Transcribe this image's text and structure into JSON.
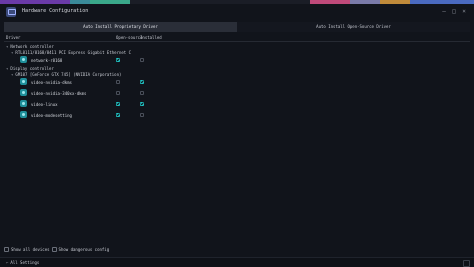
{
  "window": {
    "title": "Hardware Configuration"
  },
  "tabs": [
    {
      "label": "Auto Install Proprietary Driver",
      "active": true
    },
    {
      "label": "Auto Install Open-Source Driver",
      "active": false
    }
  ],
  "columns": {
    "driver": "Driver",
    "open_source": "Open-source",
    "installed": "Installed"
  },
  "groups": [
    {
      "label": "Network controller",
      "device": "RTL8111/8168/8411 PCI Express Gigabit Ethernet C",
      "drivers": [
        {
          "name": "network-r8168",
          "open_source": true,
          "installed": false
        }
      ]
    },
    {
      "label": "Display controller",
      "device": "GM107 [GeForce GTX 745] (NVIDIA Corporation)",
      "drivers": [
        {
          "name": "video-nvidia-dkms",
          "open_source": false,
          "installed": true
        },
        {
          "name": "video-nvidia-340xx-dkms",
          "open_source": false,
          "installed": false
        },
        {
          "name": "video-linux",
          "open_source": true,
          "installed": true
        },
        {
          "name": "video-modesetting",
          "open_source": true,
          "installed": false
        }
      ]
    }
  ],
  "options": {
    "show_all_devices": "Show all devices",
    "show_dangerous": "Show dangerous config"
  },
  "footer": {
    "all_settings": "All Settings"
  },
  "colors": {
    "accent": "#22c3c3",
    "background": "#11141b"
  }
}
